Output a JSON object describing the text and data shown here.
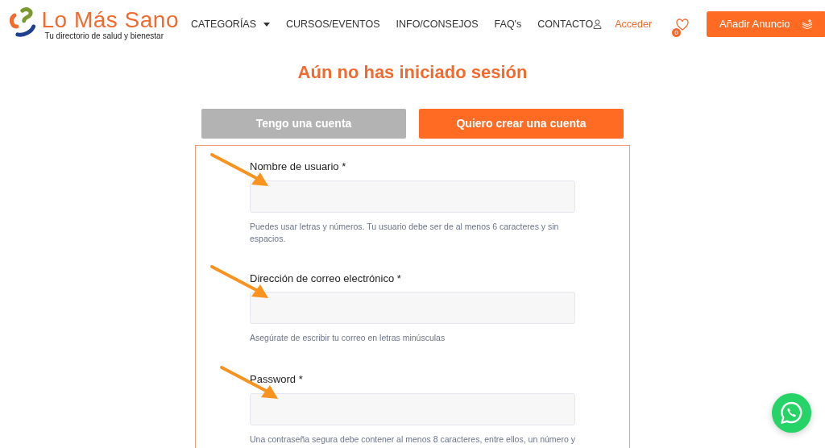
{
  "header": {
    "logo": {
      "title": "Lo Más Sano",
      "tagline": "Tu directorio de salud y bienestar"
    },
    "nav": [
      {
        "label": "CATEGORÍAS",
        "dropdown": true
      },
      {
        "label": "CURSOS/EVENTOS",
        "dropdown": false
      },
      {
        "label": "INFO/CONSEJOS",
        "dropdown": false
      },
      {
        "label": "FAQ's",
        "dropdown": false
      },
      {
        "label": "CONTACTO",
        "dropdown": false
      }
    ],
    "login": "Acceder",
    "favorites_count": "0",
    "add_button": "Añadir Anuncio"
  },
  "title": "Aún no has iniciado sesión",
  "tabs": [
    {
      "label": "Tengo una cuenta",
      "selected": false
    },
    {
      "label": "Quiero crear una cuenta",
      "selected": true
    }
  ],
  "fields": [
    {
      "label": "Nombre de usuario *",
      "help": "Puedes usar letras y números. Tu usuario debe ser de al menos 6 caracteres y sin espacios."
    },
    {
      "label": "Dirección de correo electrónico *",
      "help": "Asegúrate de escribir tu correo en letras minúsculas"
    },
    {
      "label": "Password *",
      "help": "Una contraseña segura debe contener al menos 8 caracteres, entre ellos, un número y"
    }
  ]
}
